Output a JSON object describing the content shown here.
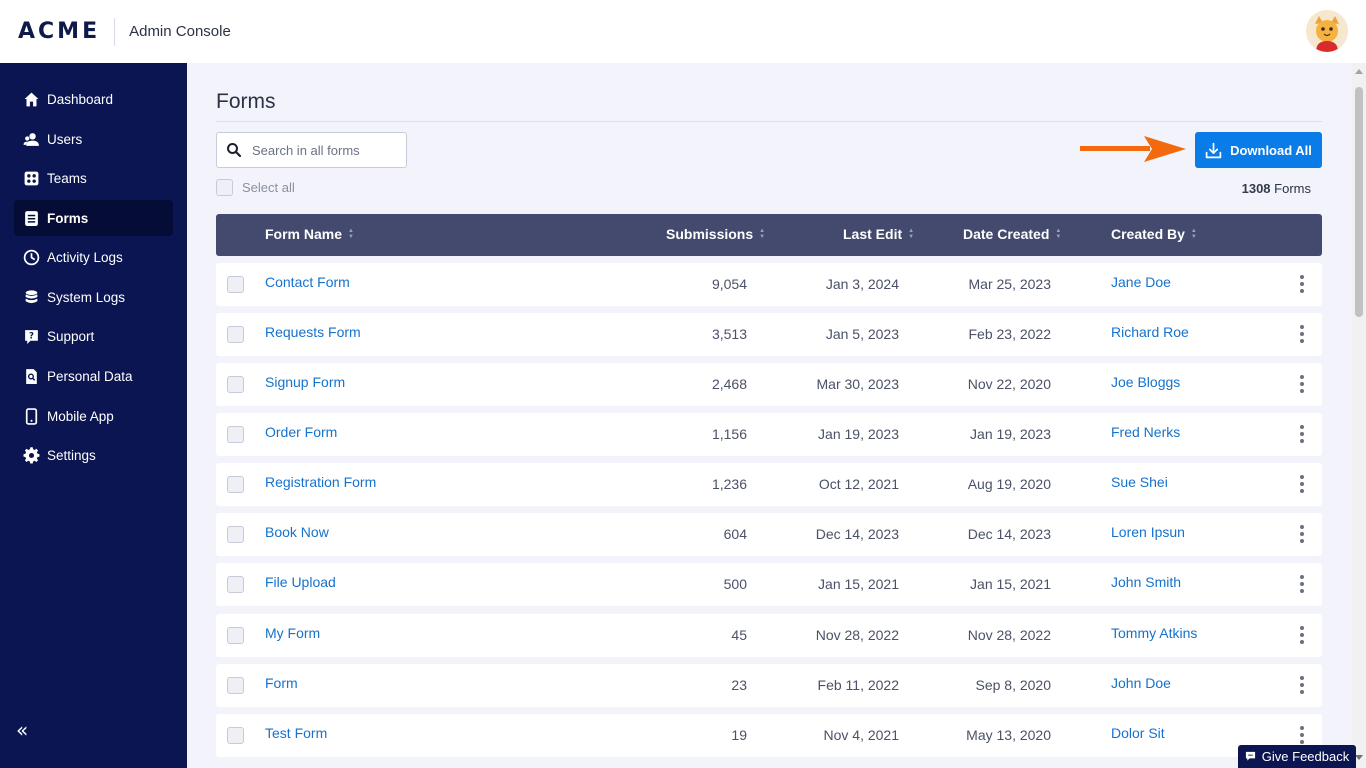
{
  "header": {
    "logo": "ACME",
    "app_title": "Admin Console"
  },
  "sidebar": {
    "items": [
      {
        "label": "Dashboard",
        "icon": "home-icon"
      },
      {
        "label": "Users",
        "icon": "users-icon"
      },
      {
        "label": "Teams",
        "icon": "teams-icon"
      },
      {
        "label": "Forms",
        "icon": "forms-icon",
        "active": true
      },
      {
        "label": "Activity Logs",
        "icon": "clock-icon"
      },
      {
        "label": "System Logs",
        "icon": "database-icon"
      },
      {
        "label": "Support",
        "icon": "help-icon"
      },
      {
        "label": "Personal Data",
        "icon": "personal-data-icon"
      },
      {
        "label": "Mobile App",
        "icon": "mobile-icon"
      },
      {
        "label": "Settings",
        "icon": "gear-icon"
      }
    ],
    "collapse_label": "«"
  },
  "main": {
    "title": "Forms",
    "search_placeholder": "Search in all forms",
    "select_all_label": "Select all",
    "download_button": "Download All",
    "form_count": "1308",
    "form_count_suffix": "Forms"
  },
  "table": {
    "columns": [
      "Form Name",
      "Submissions",
      "Last Edit",
      "Date Created",
      "Created By"
    ],
    "rows": [
      {
        "name": "Contact Form",
        "submissions": "9,054",
        "last_edit": "Jan 3, 2024",
        "created": "Mar 25, 2023",
        "by": "Jane Doe"
      },
      {
        "name": "Requests Form",
        "submissions": "3,513",
        "last_edit": "Jan 5, 2023",
        "created": "Feb 23, 2022",
        "by": "Richard Roe"
      },
      {
        "name": "Signup Form",
        "submissions": "2,468",
        "last_edit": "Mar 30, 2023",
        "created": "Nov 22, 2020",
        "by": "Joe Bloggs"
      },
      {
        "name": "Order Form",
        "submissions": "1,156",
        "last_edit": "Jan 19, 2023",
        "created": "Jan 19, 2023",
        "by": "Fred Nerks"
      },
      {
        "name": "Registration Form",
        "submissions": "1,236",
        "last_edit": "Oct 12, 2021",
        "created": "Aug 19, 2020",
        "by": "Sue Shei"
      },
      {
        "name": "Book Now",
        "submissions": "604",
        "last_edit": "Dec 14, 2023",
        "created": "Dec 14, 2023",
        "by": "Loren Ipsun"
      },
      {
        "name": "File Upload",
        "submissions": "500",
        "last_edit": "Jan 15, 2021",
        "created": "Jan 15, 2021",
        "by": "John Smith"
      },
      {
        "name": "My Form",
        "submissions": "45",
        "last_edit": "Nov 28, 2022",
        "created": "Nov 28, 2022",
        "by": "Tommy Atkins"
      },
      {
        "name": "Form",
        "submissions": "23",
        "last_edit": "Feb 11, 2022",
        "created": "Sep 8, 2020",
        "by": "John Doe"
      },
      {
        "name": "Test Form",
        "submissions": "19",
        "last_edit": "Nov 4, 2021",
        "created": "May 13, 2020",
        "by": "Dolor Sit"
      }
    ]
  },
  "feedback_label": "Give Feedback",
  "colors": {
    "sidebar_bg": "#0a1551",
    "accent": "#0a7ce8",
    "arrow": "#f26a0d",
    "table_header": "#434a6e",
    "link": "#1672cc"
  }
}
